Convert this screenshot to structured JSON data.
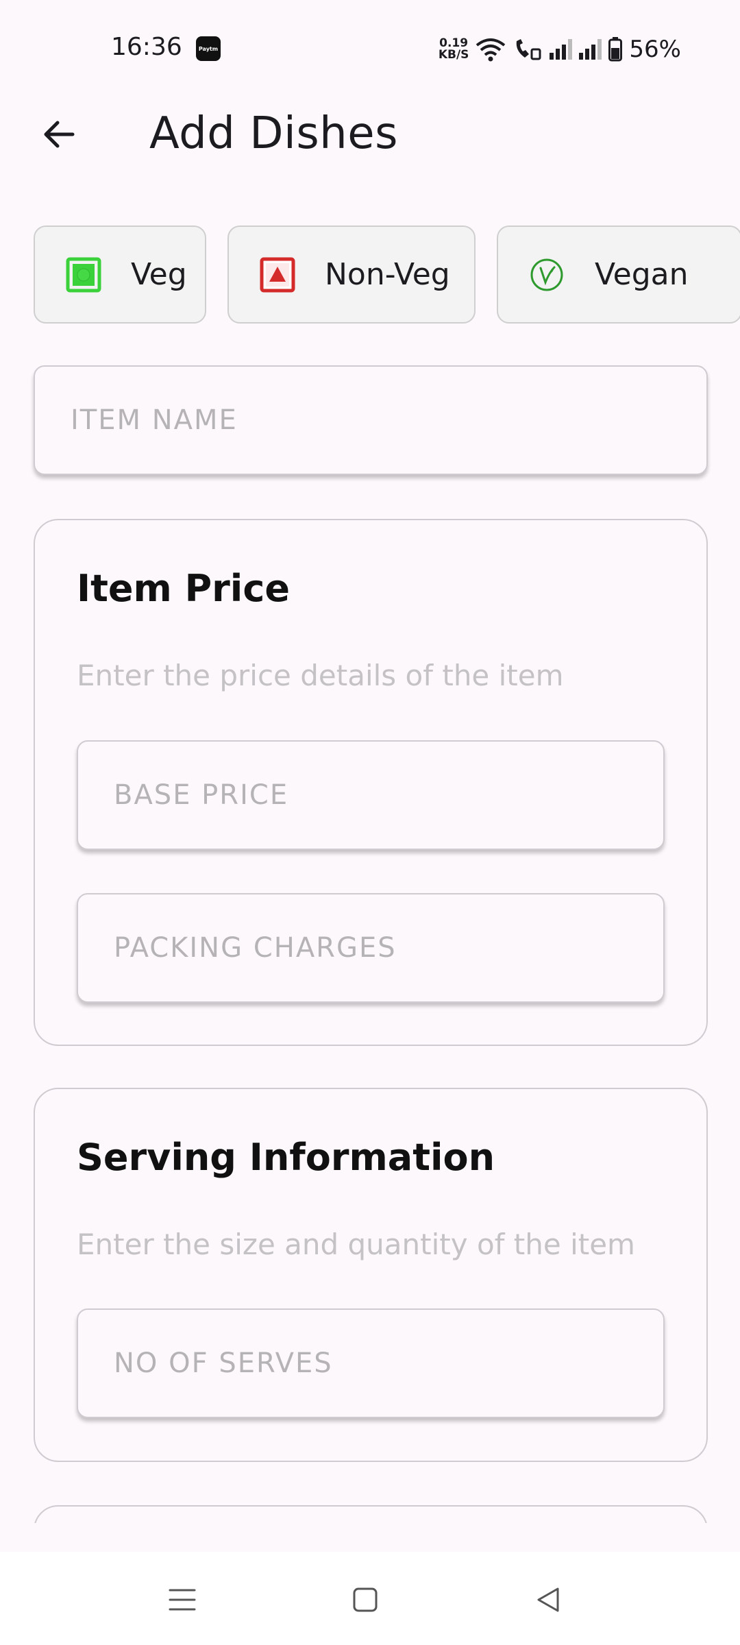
{
  "status_bar": {
    "time": "16:36",
    "app_icon": "Paytm",
    "net_speed_value": "0.19",
    "net_speed_unit": "KB/S",
    "battery": "56%"
  },
  "header": {
    "title": "Add Dishes"
  },
  "diet_chips": [
    {
      "label": "Veg",
      "icon": "veg-icon",
      "color": "#3ad13a"
    },
    {
      "label": "Non-Veg",
      "icon": "non-veg-icon",
      "color": "#d42a2a"
    },
    {
      "label": "Vegan",
      "icon": "vegan-leaf-icon",
      "color": "#2e9a2e"
    }
  ],
  "item_name": {
    "placeholder": "ITEM NAME",
    "value": ""
  },
  "price_card": {
    "title": "Item Price",
    "subtitle": "Enter the price details of the item",
    "base_price_placeholder": "BASE PRICE",
    "packing_charges_placeholder": "PACKING CHARGES"
  },
  "serving_card": {
    "title": "Serving Information",
    "subtitle": "Enter the size and quantity of the item",
    "serves_placeholder": "NO OF SERVES"
  },
  "nav": {
    "menu_icon": "menu-icon",
    "home_icon": "home-square-icon",
    "back_icon": "back-triangle-icon"
  }
}
